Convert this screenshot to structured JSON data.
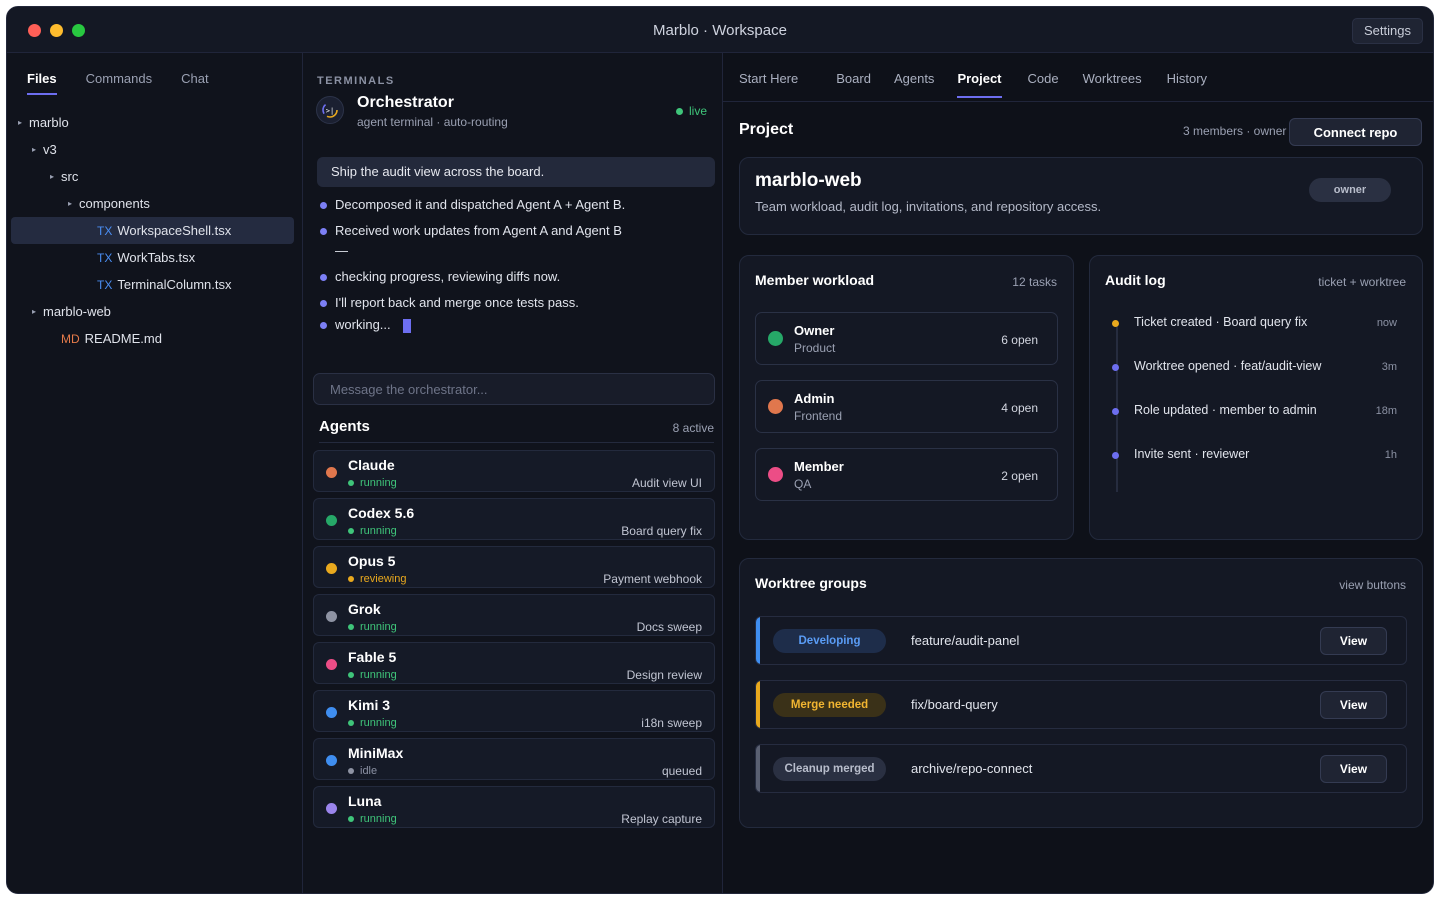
{
  "window": {
    "title": "Marblo · Workspace",
    "settings_label": "Settings"
  },
  "files_panel": {
    "tabs": [
      {
        "label": "Files",
        "active": true
      },
      {
        "label": "Commands",
        "active": false
      },
      {
        "label": "Chat",
        "active": false
      }
    ],
    "tree": [
      {
        "label": "marblo",
        "kind": "folder"
      },
      {
        "label": "v3",
        "kind": "folder"
      },
      {
        "label": "src",
        "kind": "folder"
      },
      {
        "label": "components",
        "kind": "folder"
      },
      {
        "label": "WorkspaceShell.tsx",
        "kind": "file",
        "type": "TX",
        "selected": true
      },
      {
        "label": "WorkTabs.tsx",
        "kind": "file",
        "type": "TX"
      },
      {
        "label": "TerminalColumn.tsx",
        "kind": "file",
        "type": "TX"
      },
      {
        "label": "marblo-web",
        "kind": "folder"
      },
      {
        "label": "README.md",
        "kind": "file",
        "type": "MD"
      }
    ]
  },
  "terminals": {
    "section_label": "TERMINALS",
    "orchestrator": {
      "title": "Orchestrator",
      "subtitle": "agent terminal · auto-routing",
      "status": "live"
    },
    "prompt": "Ship the audit view across the board.",
    "log": [
      "Decomposed it and dispatched Agent A + Agent B.",
      "Received work updates from Agent A and Agent B —",
      "checking progress, reviewing diffs now.",
      "I'll report back and merge once tests pass.",
      "working..."
    ],
    "input_placeholder": "Message the orchestrator...",
    "agents_title": "Agents",
    "agents_count": "8 active",
    "agents": [
      {
        "name": "Claude",
        "status": "running",
        "task": "Audit view UI",
        "color": "#e0774d"
      },
      {
        "name": "Codex 5.6",
        "status": "running",
        "task": "Board query fix",
        "color": "#26a868"
      },
      {
        "name": "Opus 5",
        "status": "reviewing",
        "task": "Payment webhook",
        "color": "#e9a91e"
      },
      {
        "name": "Grok",
        "status": "running",
        "task": "Docs sweep",
        "color": "#8e93a3"
      },
      {
        "name": "Fable 5",
        "status": "running",
        "task": "Design review",
        "color": "#ec4d86"
      },
      {
        "name": "Kimi 3",
        "status": "running",
        "task": "i18n sweep",
        "color": "#3f8ef0"
      },
      {
        "name": "MiniMax",
        "status": "idle",
        "task": "queued",
        "color": "#3f8ef0"
      },
      {
        "name": "Luna",
        "status": "running",
        "task": "Replay capture",
        "color": "#9b85ec"
      }
    ]
  },
  "right": {
    "tabs": [
      {
        "label": "Start Here",
        "active": false
      },
      {
        "label": "Board",
        "active": false
      },
      {
        "label": "Agents",
        "active": false
      },
      {
        "label": "Project",
        "active": true
      },
      {
        "label": "Code",
        "active": false
      },
      {
        "label": "Worktrees",
        "active": false
      },
      {
        "label": "History",
        "active": false
      }
    ],
    "heading": "Project",
    "meta": "3 members · owner",
    "connect_label": "Connect repo",
    "project": {
      "name": "marblo-web",
      "description": "Team workload, audit log, invitations, and repository access.",
      "badge": "owner"
    },
    "workload": {
      "title": "Member workload",
      "meta": "12 tasks",
      "members": [
        {
          "role": "Owner",
          "team": "Product",
          "open": "6 open",
          "color": "#26a868"
        },
        {
          "role": "Admin",
          "team": "Frontend",
          "open": "4 open",
          "color": "#e0774d"
        },
        {
          "role": "Member",
          "team": "QA",
          "open": "2 open",
          "color": "#ec4d86"
        }
      ]
    },
    "audit": {
      "title": "Audit log",
      "meta": "ticket + worktree",
      "entries": [
        {
          "text": "Ticket created · Board query fix",
          "time": "now",
          "color": "#e9a91e"
        },
        {
          "text": "Worktree opened · feat/audit-view",
          "time": "3m",
          "color": "#6d6ef0"
        },
        {
          "text": "Role updated · member to admin",
          "time": "18m",
          "color": "#6d6ef0"
        },
        {
          "text": "Invite sent · reviewer",
          "time": "1h",
          "color": "#6d6ef0"
        }
      ]
    },
    "worktrees": {
      "title": "Worktree groups",
      "meta": "view buttons",
      "view_label": "View",
      "groups": [
        {
          "badge": "Developing",
          "branch": "feature/audit-panel",
          "bar": "#3f8ef0",
          "badge_bg": "#1e2d4a",
          "badge_fg": "#5a9cf5"
        },
        {
          "badge": "Merge needed",
          "branch": "fix/board-query",
          "bar": "#e9a91e",
          "badge_bg": "#3a3118",
          "badge_fg": "#f1b531"
        },
        {
          "badge": "Cleanup merged",
          "branch": "archive/repo-connect",
          "bar": "#5a6072",
          "badge_bg": "#2a3042",
          "badge_fg": "#b8bdcb"
        }
      ]
    }
  }
}
